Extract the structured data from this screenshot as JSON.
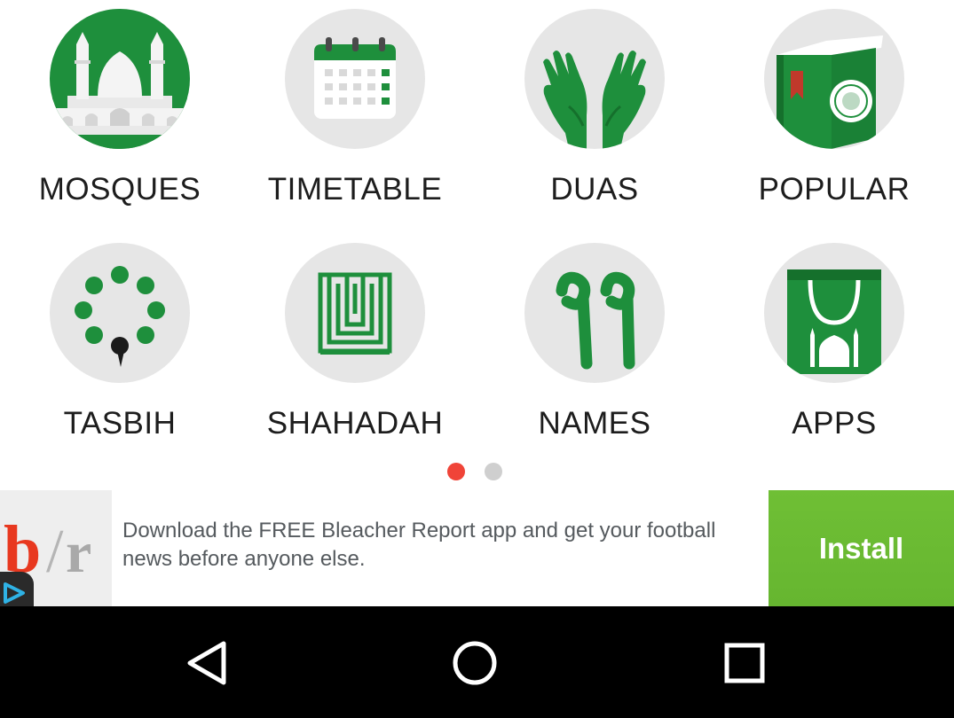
{
  "colors": {
    "brand_green": "#1e8f3c",
    "dark_green": "#15702c",
    "circle_bg": "#e6e6e6",
    "active_dot": "#f04438",
    "inactive_dot": "#cfcfcf",
    "install_green": "#66b630"
  },
  "menu": [
    {
      "label": "MOSQUES",
      "icon": "mosque-icon"
    },
    {
      "label": "TIMETABLE",
      "icon": "calendar-icon"
    },
    {
      "label": "DUAS",
      "icon": "praying-hands-icon"
    },
    {
      "label": "POPULAR",
      "icon": "book-icon"
    },
    {
      "label": "TASBIH",
      "icon": "prayer-beads-icon"
    },
    {
      "label": "SHAHADAH",
      "icon": "kufic-calligraphy-icon"
    },
    {
      "label": "NAMES",
      "icon": "arabic-99-icon"
    },
    {
      "label": "APPS",
      "icon": "shopping-bag-icon"
    }
  ],
  "pager": {
    "pages": 2,
    "current": 1
  },
  "ad": {
    "logo_letters": "b/r",
    "text": "Download the FREE Bleacher Report app and get your football news before anyone else.",
    "install_label": "Install"
  },
  "navbar": {
    "back_icon": "back-triangle-icon",
    "home_icon": "home-circle-icon",
    "recents_icon": "recents-square-icon"
  }
}
